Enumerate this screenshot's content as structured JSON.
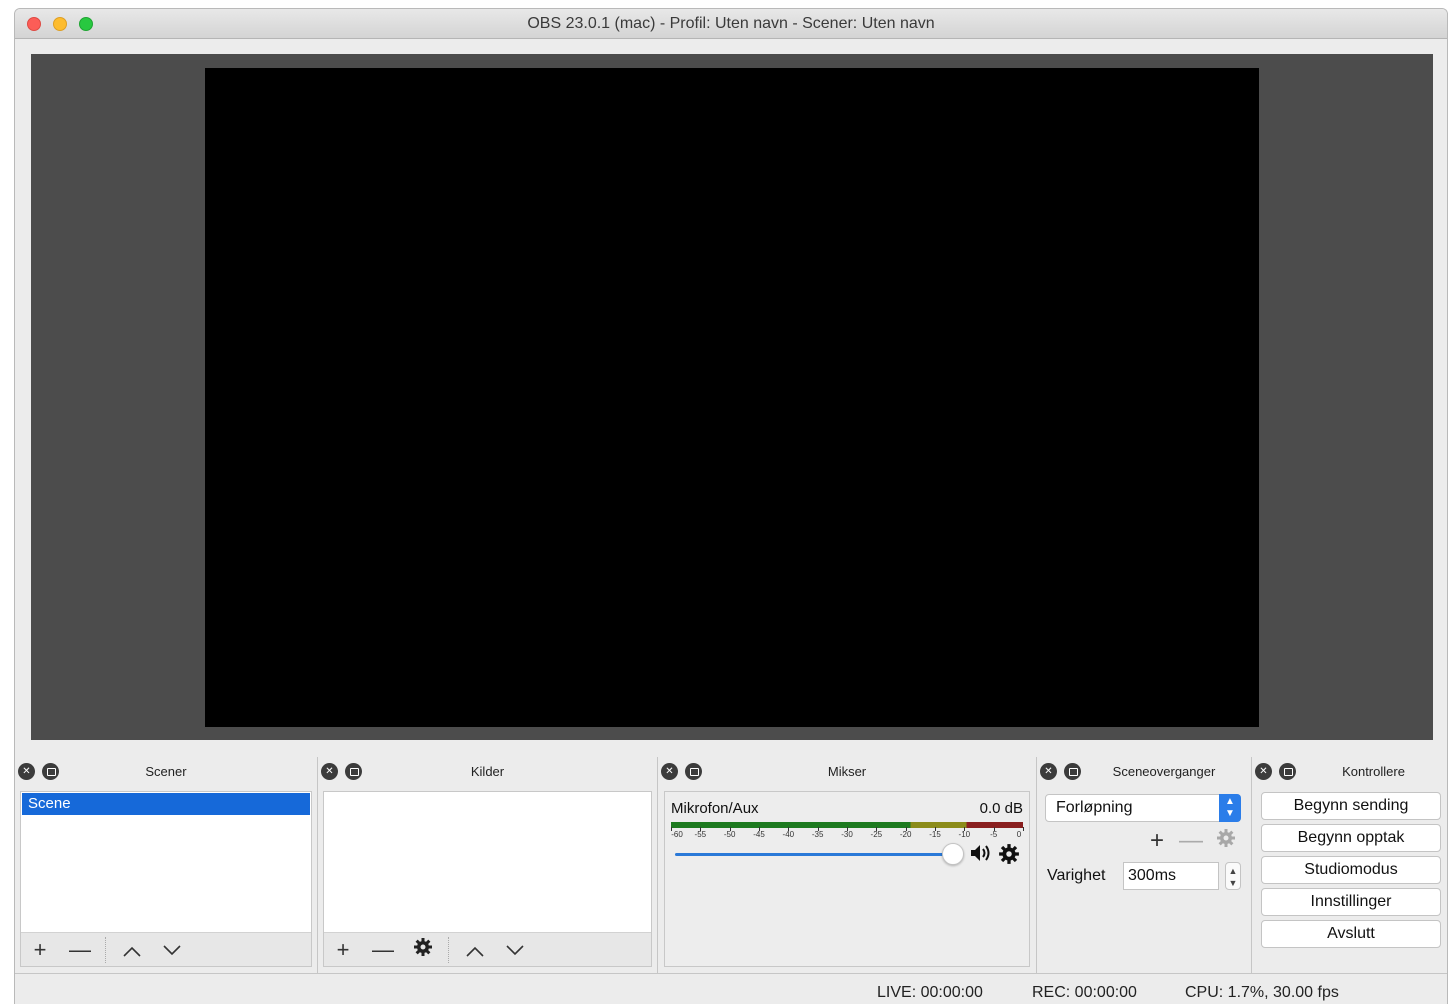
{
  "window": {
    "title": "OBS 23.0.1 (mac) - Profil: Uten navn - Scener: Uten navn"
  },
  "docks": {
    "scenes": {
      "title": "Scener",
      "items": [
        "Scene"
      ],
      "selected_index": 0
    },
    "sources": {
      "title": "Kilder",
      "items": []
    },
    "mixer": {
      "title": "Mikser",
      "channels": [
        {
          "name": "Mikrofon/Aux",
          "level": "0.0 dB",
          "volume_fraction": 1.0
        }
      ],
      "meter_ticks": [
        "-60",
        "-55",
        "-50",
        "-45",
        "-40",
        "-35",
        "-30",
        "-25",
        "-20",
        "-15",
        "-10",
        "-5",
        "0"
      ]
    },
    "transitions": {
      "title": "Sceneoverganger",
      "selected": "Forløpning",
      "duration_label": "Varighet",
      "duration_value": "300ms"
    },
    "controls": {
      "title": "Kontrollere",
      "buttons": [
        "Begynn sending",
        "Begynn opptak",
        "Studiomodus",
        "Innstillinger",
        "Avslutt"
      ]
    }
  },
  "status": {
    "live": "LIVE: 00:00:00",
    "rec": "REC: 00:00:00",
    "cpu": "CPU: 1.7%, 30.00 fps"
  },
  "colors": {
    "selection": "#1669d9",
    "preview_background": "#4c4c4c",
    "canvas": "#000000",
    "slider": "#2a79d8"
  }
}
